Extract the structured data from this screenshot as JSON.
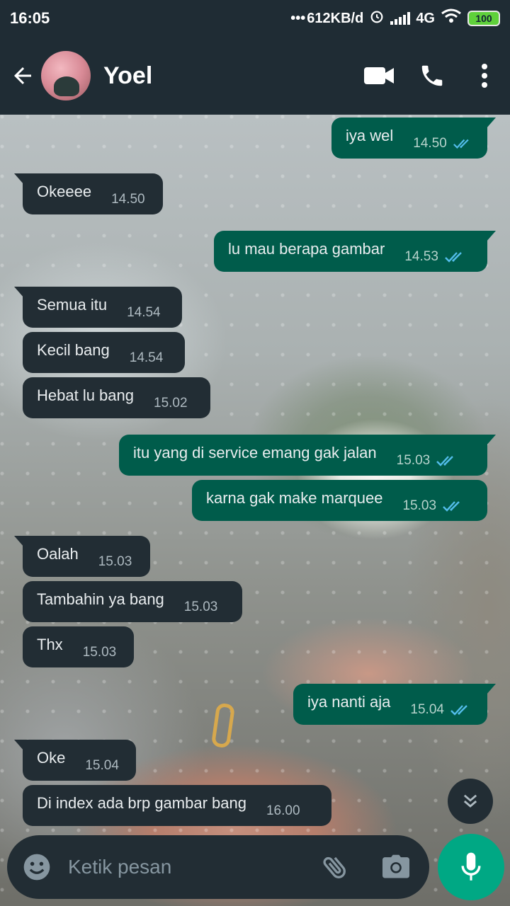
{
  "status_bar": {
    "time": "16:05",
    "dots": "•••",
    "net_speed": "612KB/d",
    "network": "4G",
    "battery": "100"
  },
  "header": {
    "contact_name": "Yoel",
    "icons": [
      "back-arrow-icon",
      "video-call-icon",
      "voice-call-icon",
      "more-vert-icon"
    ]
  },
  "messages": [
    {
      "dir": "out",
      "text": "iya wel",
      "time": "14.50",
      "read": true
    },
    {
      "dir": "in",
      "text": "Okeeee",
      "time": "14.50"
    },
    {
      "dir": "out",
      "text": "lu mau berapa gambar",
      "time": "14.53",
      "read": true
    },
    {
      "dir": "in",
      "text": "Semua itu",
      "time": "14.54"
    },
    {
      "dir": "in",
      "text": "Kecil bang",
      "time": "14.54"
    },
    {
      "dir": "in",
      "text": "Hebat lu bang",
      "time": "15.02"
    },
    {
      "dir": "out",
      "text": "itu yang di service emang gak jalan",
      "time": "15.03",
      "read": true
    },
    {
      "dir": "out",
      "text": "karna gak make marquee",
      "time": "15.03",
      "read": true
    },
    {
      "dir": "in",
      "text": "Oalah",
      "time": "15.03"
    },
    {
      "dir": "in",
      "text": "Tambahin ya bang",
      "time": "15.03"
    },
    {
      "dir": "in",
      "text": "Thx",
      "time": "15.03"
    },
    {
      "dir": "out",
      "text": "iya nanti aja",
      "time": "15.04",
      "read": true
    },
    {
      "dir": "in",
      "text": "Oke",
      "time": "15.04"
    },
    {
      "dir": "in",
      "text": "Di index ada brp gambar bang",
      "time": "16.00"
    }
  ],
  "input": {
    "placeholder": "Ketik pesan"
  },
  "colors": {
    "header_bg": "#1f2c34",
    "incoming_bubble": "#222d34",
    "outgoing_bubble": "#005c4b",
    "read_tick": "#53bdeb",
    "mic_button": "#00a884"
  }
}
